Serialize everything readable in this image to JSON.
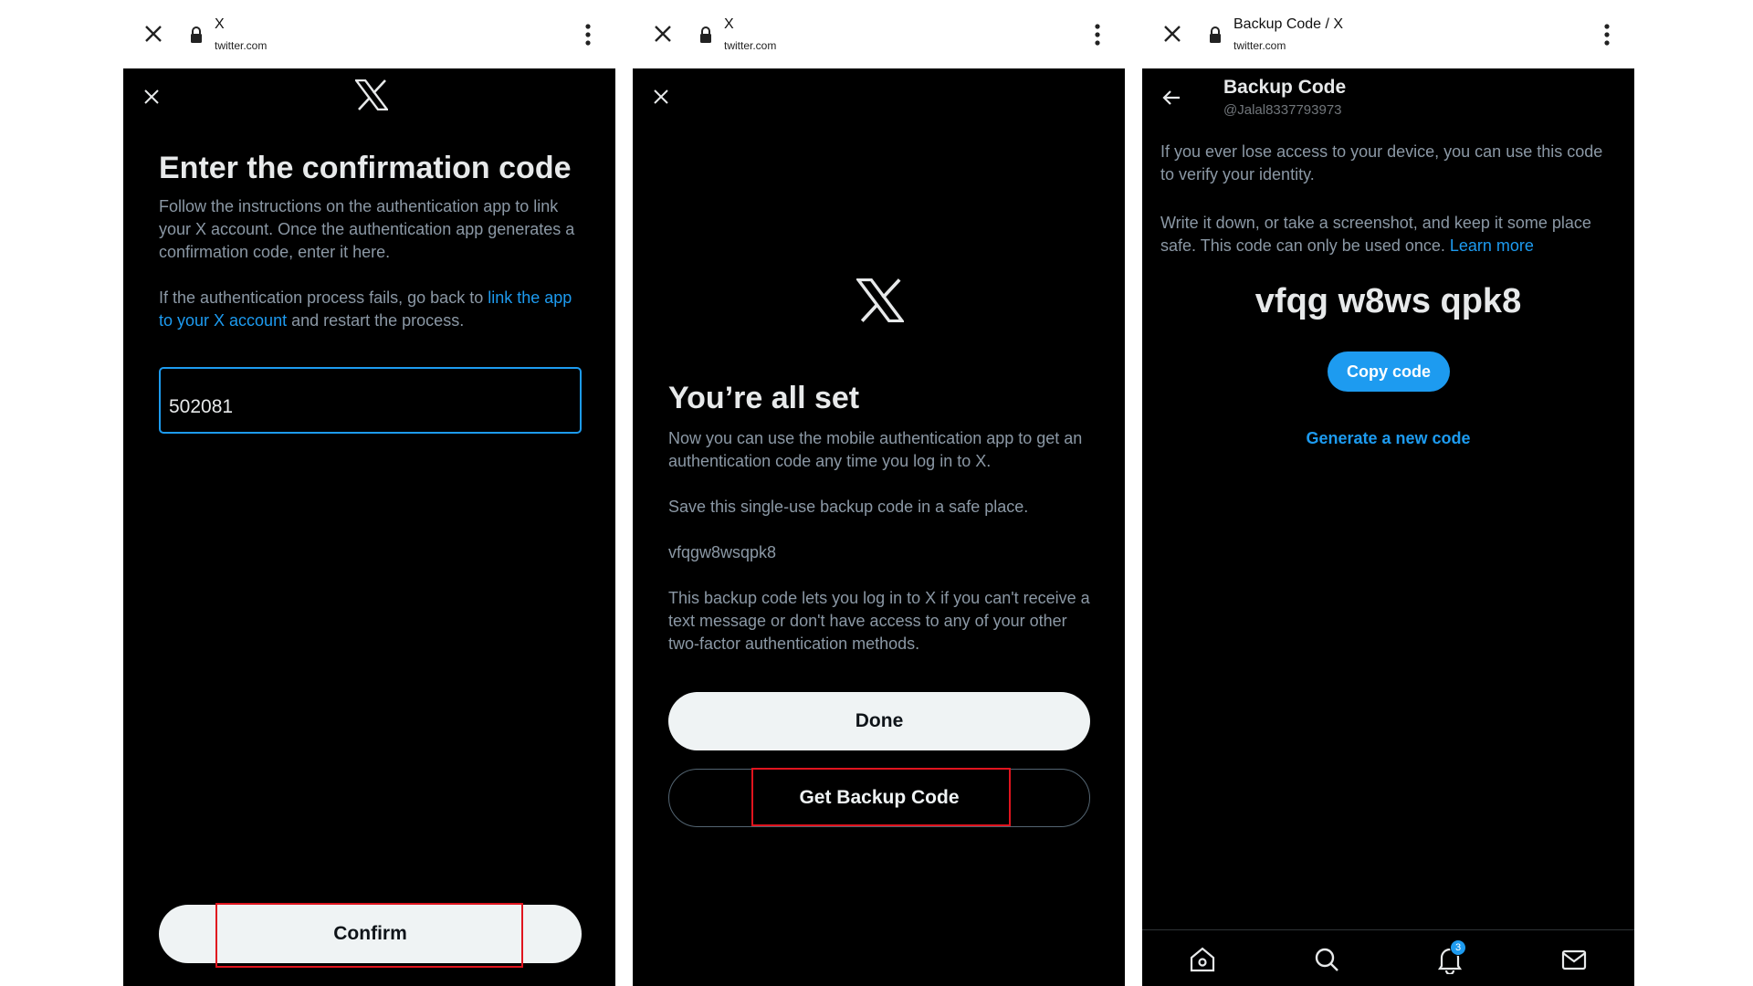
{
  "colors": {
    "accent": "#1d9bf0",
    "highlight": "#e0141e",
    "background": "#000000"
  },
  "panel1": {
    "browser": {
      "title": "X",
      "url": "twitter.com"
    },
    "heading": "Enter the confirmation code",
    "instructions": "Follow the instructions on the authentication app to link your X account. Once the authentication app generates a confirmation code, enter it here.",
    "fail_prefix": "If the authentication process fails, go back to ",
    "fail_link": "link the app to your X account",
    "fail_suffix": " and restart the process.",
    "code_value": "502081",
    "confirm_label": "Confirm"
  },
  "panel2": {
    "browser": {
      "title": "X",
      "url": "twitter.com"
    },
    "heading": "You’re all set",
    "para1": "Now you can use the mobile authentication app to get an authentication code any time you log in to X.",
    "para2": "Save this single-use backup code in a safe place.",
    "backup_code": "vfqgw8wsqpk8",
    "para3": "This backup code lets you log in to X if you can't receive a text message or don't have access to any of your other two-factor authentication methods.",
    "done_label": "Done",
    "get_backup_label": "Get Backup Code"
  },
  "panel3": {
    "browser": {
      "title": "Backup Code / X",
      "url": "twitter.com"
    },
    "title": "Backup Code",
    "handle": "@Jalal8337793973",
    "para1": "If you ever lose access to your device, you can use this code to verify your identity.",
    "para2": "Write it down, or take a screenshot, and keep it some place safe. This code can only be used once.",
    "learn_more": "Learn more",
    "code": "vfqg w8ws qpk8",
    "copy_label": "Copy code",
    "generate_label": "Generate a new code",
    "notifications_badge": "3",
    "tabs": [
      "home-icon",
      "search-icon",
      "bell-icon",
      "mail-icon"
    ]
  }
}
